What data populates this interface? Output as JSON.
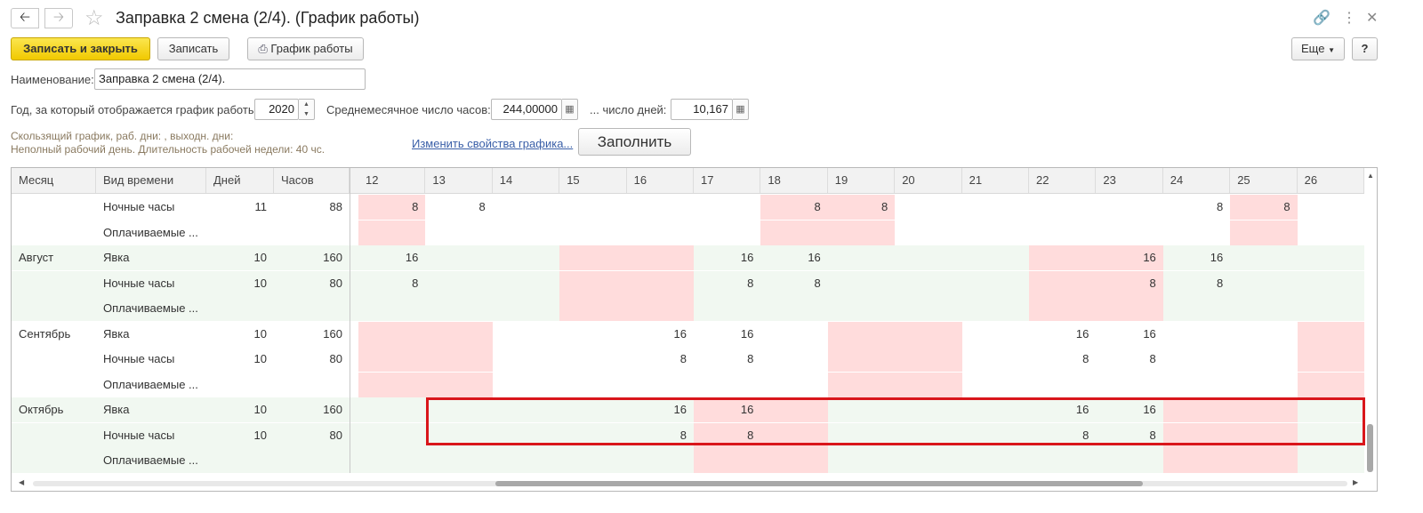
{
  "window": {
    "title": "Заправка 2 смена (2/4). (График работы)",
    "back_icon": "arrow-left-icon",
    "forward_icon": "arrow-right-icon",
    "favorite_icon": "star-icon"
  },
  "toolbar": {
    "save_close": "Записать и закрыть",
    "save": "Записать",
    "schedule": "График работы",
    "more": "Еще",
    "help": "?"
  },
  "form": {
    "name_label": "Наименование:",
    "name_value": "Заправка 2 смена (2/4).",
    "year_label": "Год, за который отображается график работы:",
    "year_value": "2020",
    "avg_hours_label": "Среднемесячное число часов:",
    "avg_hours_value": "244,00000",
    "days_label": "... число дней:",
    "days_value": "10,167",
    "hint_line1": "Скользящий график, раб. дни: , выходн. дни:",
    "hint_line2": "Неполный рабочий день. Длительность рабочей недели: 40 чс.",
    "change_link": "Изменить свойства графика...",
    "fill_button": "Заполнить"
  },
  "table": {
    "headers": [
      "Месяц",
      "Вид времени",
      "Дней",
      "Часов"
    ],
    "day_headers": [
      "12",
      "13",
      "14",
      "15",
      "16",
      "17",
      "18",
      "19",
      "20",
      "21",
      "22",
      "23",
      "24",
      "25",
      "26"
    ],
    "rows": [
      {
        "month": "",
        "kind": "Ночные часы",
        "days": "11",
        "hours": "88",
        "cells": [
          "8",
          "8",
          "",
          "",
          "",
          "",
          "8",
          "8",
          "",
          "",
          "",
          "",
          "8",
          "8",
          ""
        ]
      },
      {
        "month": "",
        "kind": "Оплачиваемые ...",
        "days": "",
        "hours": "",
        "cells": [
          "",
          "",
          "",
          "",
          "",
          "",
          "",
          "",
          "",
          "",
          "",
          "",
          "",
          "",
          ""
        ]
      },
      {
        "month": "Август",
        "kind": "Явка",
        "days": "10",
        "hours": "160",
        "cells": [
          "16",
          "",
          "",
          "",
          "",
          "16",
          "16",
          "",
          "",
          "",
          "",
          "16",
          "16",
          "",
          ""
        ]
      },
      {
        "month": "",
        "kind": "Ночные часы",
        "days": "10",
        "hours": "80",
        "cells": [
          "8",
          "",
          "",
          "",
          "",
          "8",
          "8",
          "",
          "",
          "",
          "",
          "8",
          "8",
          "",
          ""
        ]
      },
      {
        "month": "",
        "kind": "Оплачиваемые ...",
        "days": "",
        "hours": "",
        "cells": [
          "",
          "",
          "",
          "",
          "",
          "",
          "",
          "",
          "",
          "",
          "",
          "",
          "",
          "",
          ""
        ]
      },
      {
        "month": "Сентябрь",
        "kind": "Явка",
        "days": "10",
        "hours": "160",
        "cells": [
          "",
          "",
          "",
          "",
          "16",
          "16",
          "",
          "",
          "",
          "",
          "16",
          "16",
          "",
          "",
          ""
        ]
      },
      {
        "month": "",
        "kind": "Ночные часы",
        "days": "10",
        "hours": "80",
        "cells": [
          "",
          "",
          "",
          "",
          "8",
          "8",
          "",
          "",
          "",
          "",
          "8",
          "8",
          "",
          "",
          ""
        ]
      },
      {
        "month": "",
        "kind": "Оплачиваемые ...",
        "days": "",
        "hours": "",
        "cells": [
          "",
          "",
          "",
          "",
          "",
          "",
          "",
          "",
          "",
          "",
          "",
          "",
          "",
          "",
          ""
        ]
      },
      {
        "month": "Октябрь",
        "kind": "Явка",
        "days": "10",
        "hours": "160",
        "cells": [
          "",
          "",
          "",
          "",
          "16",
          "16",
          "",
          "",
          "",
          "",
          "16",
          "16",
          "",
          "",
          ""
        ]
      },
      {
        "month": "",
        "kind": "Ночные часы",
        "days": "10",
        "hours": "80",
        "cells": [
          "",
          "",
          "",
          "",
          "8",
          "8",
          "",
          "",
          "",
          "",
          "8",
          "8",
          "",
          "",
          ""
        ]
      },
      {
        "month": "",
        "kind": "Оплачиваемые ...",
        "days": "",
        "hours": "",
        "cells": [
          "",
          "",
          "",
          "",
          "",
          "",
          "",
          "",
          "",
          "",
          "",
          "",
          "",
          "",
          ""
        ]
      }
    ]
  },
  "colors": {
    "weekend_pink": "#ffdcdc",
    "group_green": "#f1f8f1",
    "highlight_red": "#d9161b",
    "primary_yellow": "#f5d31a"
  }
}
